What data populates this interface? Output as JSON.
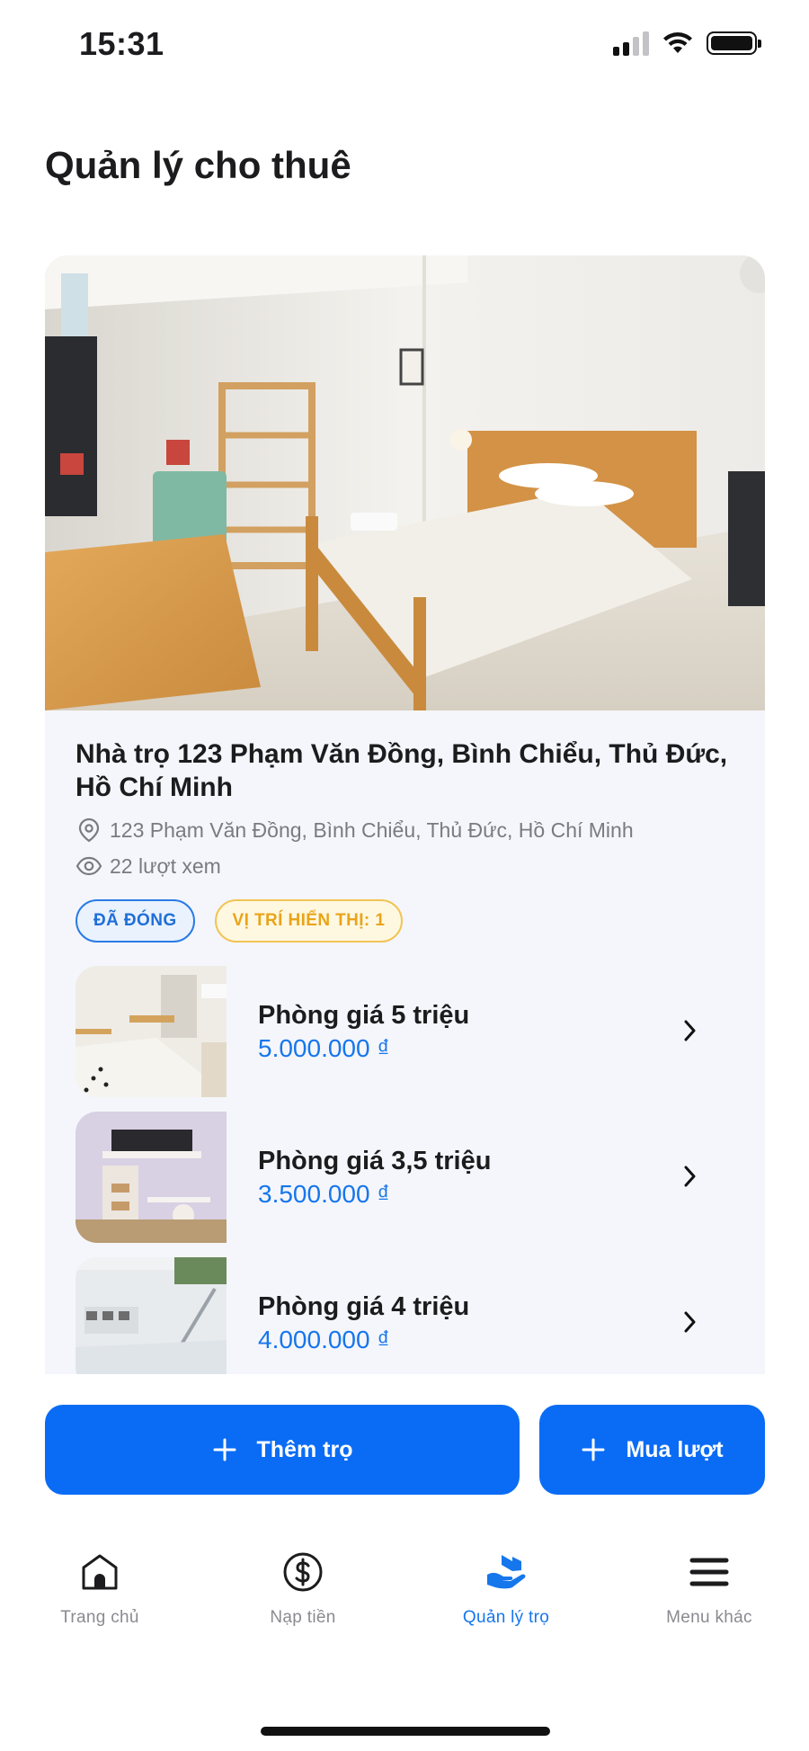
{
  "status_bar": {
    "time": "15:31"
  },
  "page": {
    "title": "Quản lý cho thuê"
  },
  "listing": {
    "title": "Nhà trọ 123 Phạm Văn Đồng, Bình Chiểu, Thủ Đức, Hồ Chí Minh",
    "address": "123 Phạm Văn Đồng, Bình Chiểu, Thủ Đức, Hồ Chí Minh",
    "views": "22 lượt xem",
    "badges": {
      "status": "ĐÃ ĐÓNG",
      "position": "VỊ TRÍ HIỂN THỊ: 1"
    },
    "rooms": [
      {
        "name": "Phòng giá 5 triệu",
        "price": "5.000.000 ₫"
      },
      {
        "name": "Phòng giá 3,5 triệu",
        "price": "3.500.000 ₫"
      },
      {
        "name": "Phòng giá 4 triệu",
        "price": "4.000.000 ₫"
      }
    ]
  },
  "actions": {
    "add_label": "Thêm trọ",
    "buy_label": "Mua lượt"
  },
  "tabbar": {
    "items": [
      {
        "label": "Trang chủ",
        "icon": "home-icon"
      },
      {
        "label": "Nạp tiền",
        "icon": "dollar-circle-icon"
      },
      {
        "label": "Quản lý trọ",
        "icon": "manage-rental-icon"
      },
      {
        "label": "Menu khác",
        "icon": "menu-icon"
      }
    ],
    "active_index": 2
  },
  "colors": {
    "accent": "#0A6CF5",
    "price": "#1676EC",
    "status_badge": "#1F6FD8",
    "position_badge": "#E9A41A"
  }
}
